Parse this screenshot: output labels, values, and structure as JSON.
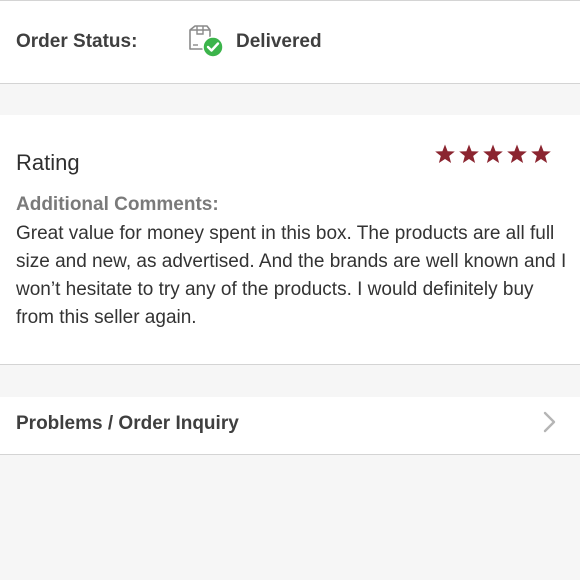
{
  "order_status": {
    "label": "Order Status:",
    "value": "Delivered",
    "icon": "delivered-box-check-icon",
    "check_color": "#3cb44b"
  },
  "rating": {
    "label": "Rating",
    "stars": 5,
    "max_stars": 5,
    "star_color": "#8b2530",
    "comments_label": "Additional Comments:",
    "comments": "Great value for money spent in this box. The products are all full size and new, as advertised. And the brands are well known and I won’t hesitate to try any of the products. I would definitely buy from this seller again."
  },
  "inquiry": {
    "label": "Problems / Order Inquiry",
    "icon": "chevron-right-icon"
  }
}
